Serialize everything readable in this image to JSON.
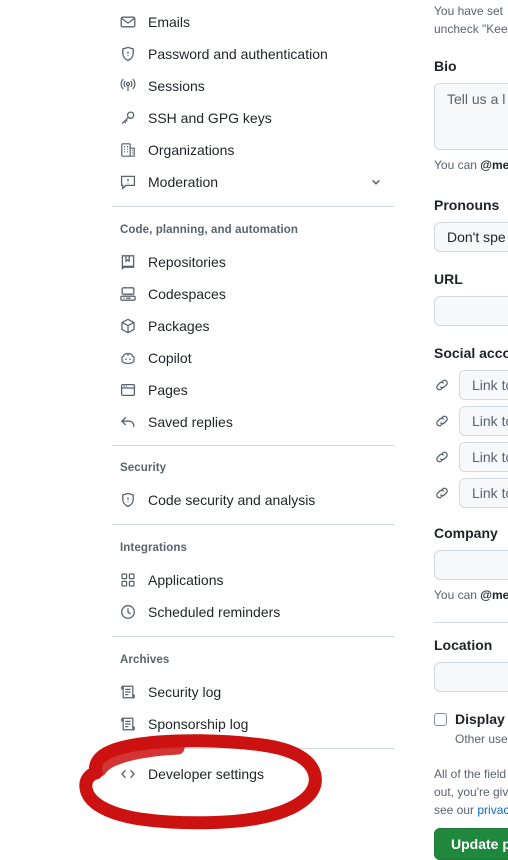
{
  "sidebar": {
    "top_items": [
      {
        "label": "Emails",
        "icon": "mail-icon"
      },
      {
        "label": "Password and authentication",
        "icon": "shield-lock-icon"
      },
      {
        "label": "Sessions",
        "icon": "broadcast-icon"
      },
      {
        "label": "SSH and GPG keys",
        "icon": "key-icon"
      },
      {
        "label": "Organizations",
        "icon": "organization-icon"
      },
      {
        "label": "Moderation",
        "icon": "report-icon",
        "expander": "chevron-down-icon"
      }
    ],
    "groups": [
      {
        "title": "Code, planning, and automation",
        "items": [
          {
            "label": "Repositories",
            "icon": "repo-icon"
          },
          {
            "label": "Codespaces",
            "icon": "codespaces-icon"
          },
          {
            "label": "Packages",
            "icon": "package-icon"
          },
          {
            "label": "Copilot",
            "icon": "copilot-icon"
          },
          {
            "label": "Pages",
            "icon": "browser-icon"
          },
          {
            "label": "Saved replies",
            "icon": "reply-icon"
          }
        ]
      },
      {
        "title": "Security",
        "items": [
          {
            "label": "Code security and analysis",
            "icon": "shield-lock-icon"
          }
        ]
      },
      {
        "title": "Integrations",
        "items": [
          {
            "label": "Applications",
            "icon": "apps-icon"
          },
          {
            "label": "Scheduled reminders",
            "icon": "clock-icon"
          }
        ]
      },
      {
        "title": "Archives",
        "items": [
          {
            "label": "Security log",
            "icon": "log-icon"
          },
          {
            "label": "Sponsorship log",
            "icon": "log-icon"
          }
        ]
      }
    ],
    "footer_items": [
      {
        "label": "Developer settings",
        "icon": "code-icon"
      }
    ]
  },
  "main": {
    "top_notice_line1": "You have set",
    "top_notice_line2": "uncheck \"Kee",
    "bio": {
      "label": "Bio",
      "placeholder": "Tell us a l",
      "hint_prefix": "You can ",
      "hint_mention": "@me"
    },
    "pronouns": {
      "label": "Pronouns",
      "value": "Don't spe"
    },
    "url": {
      "label": "URL",
      "value": ""
    },
    "social": {
      "label": "Social acco",
      "rows": [
        {
          "placeholder": "Link to"
        },
        {
          "placeholder": "Link to"
        },
        {
          "placeholder": "Link to"
        },
        {
          "placeholder": "Link to"
        }
      ]
    },
    "company": {
      "label": "Company",
      "value": "",
      "hint_prefix": "You can ",
      "hint_mention": "@me"
    },
    "location": {
      "label": "Location",
      "value": ""
    },
    "display_checkbox": {
      "label": "Display",
      "sub": "Other use",
      "checked": false
    },
    "legal": {
      "line1": "All of the field",
      "line2": "out, you're giv",
      "line3_prefix": "see our ",
      "line3_link": "privac"
    },
    "submit_button": "Update pr"
  },
  "annotation": {
    "type": "hand-drawn-ellipse",
    "color": "#cc1111",
    "target": "Developer settings"
  },
  "colors": {
    "accent_green": "#1f883d",
    "link_blue": "#0969da",
    "border": "#d1d9e0",
    "muted_text": "#59636e",
    "field_bg": "#f6f8fa",
    "annotation_red": "#cc1111"
  }
}
